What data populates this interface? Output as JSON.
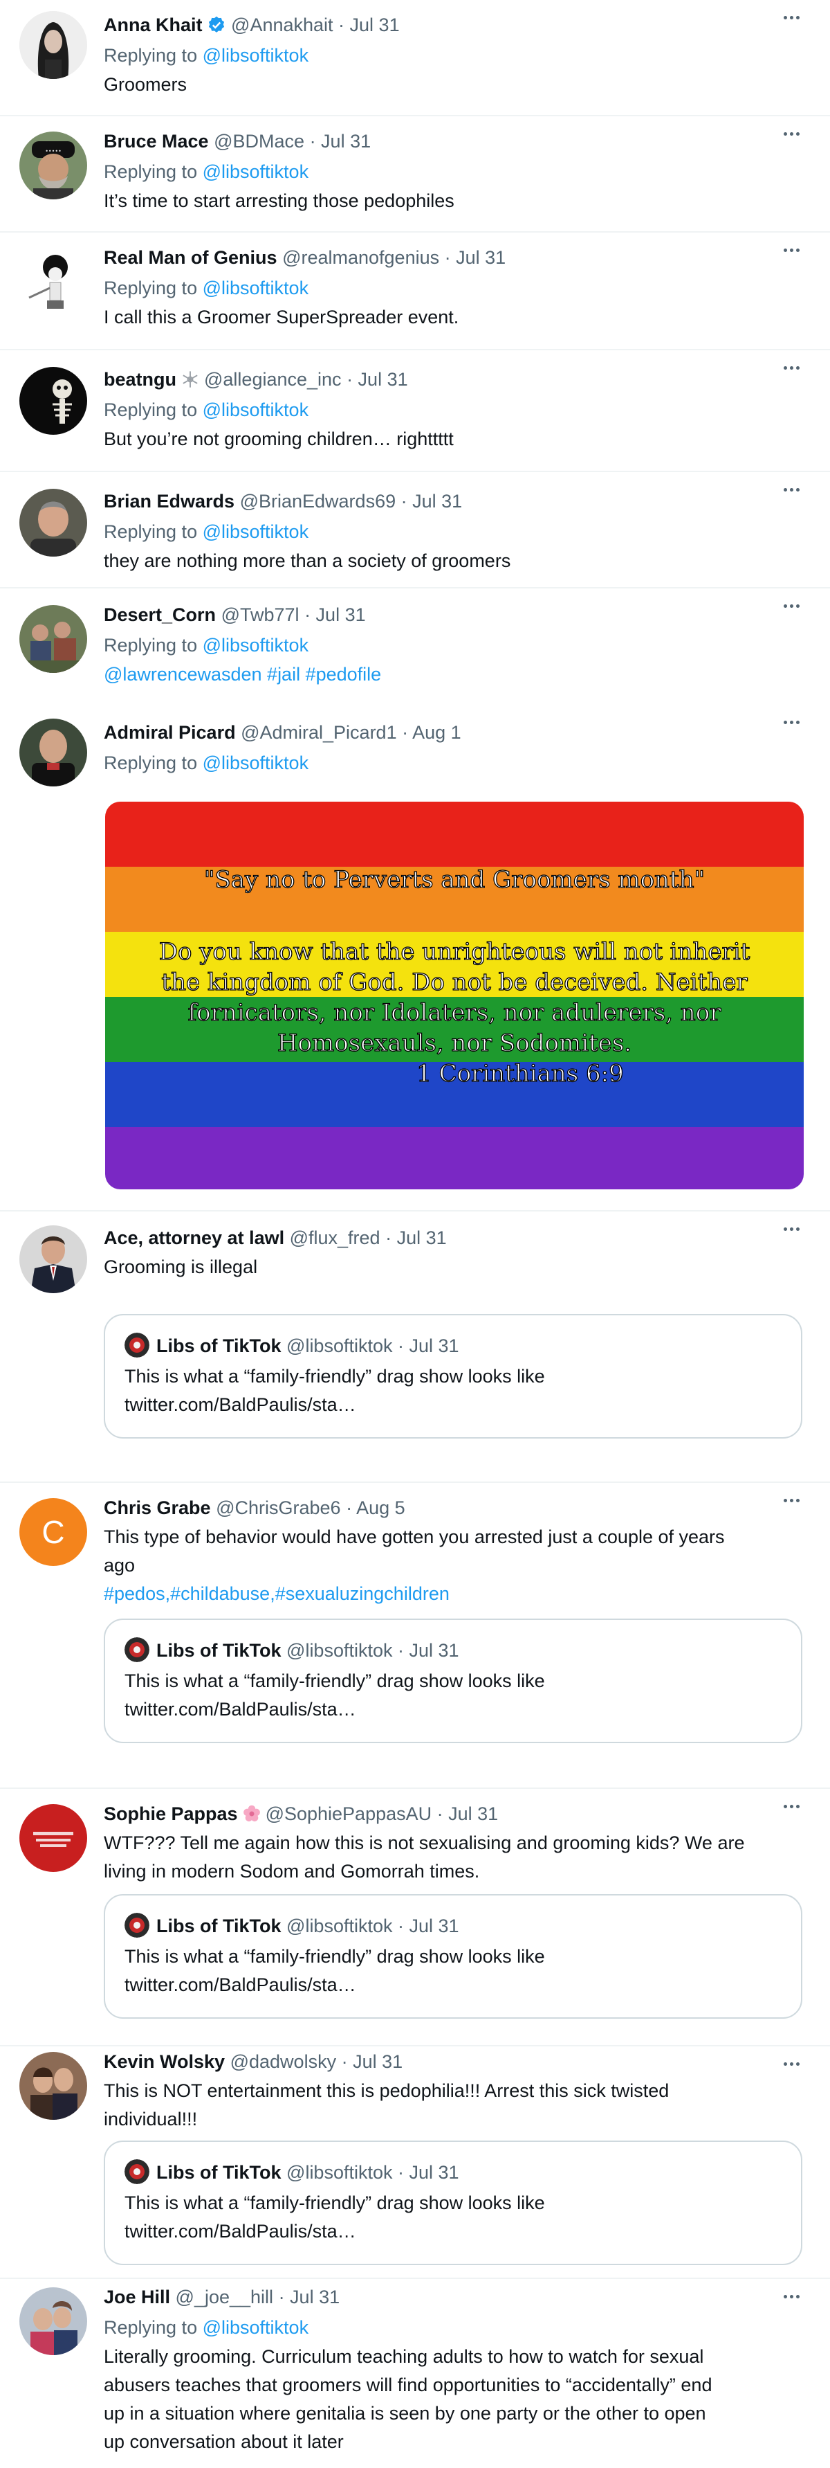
{
  "reply_label": "Replying to",
  "tweets": [
    {
      "name": "Anna Khait",
      "handle": "@Annakhait",
      "date": "· Jul 31",
      "replying_to": "@libsoftiktok",
      "text": "Groomers"
    },
    {
      "name": "Bruce Mace",
      "handle": "@BDMace",
      "date": "· Jul 31",
      "replying_to": "@libsoftiktok",
      "text": "It’s time to start arresting those pedophiles"
    },
    {
      "name": "Real Man of Genius",
      "handle": "@realmanofgenius",
      "date": "· Jul 31",
      "replying_to": "@libsoftiktok",
      "text": "I call this a Groomer SuperSpreader event."
    },
    {
      "name": "beatngu",
      "handle": "@allegiance_inc",
      "date": "· Jul 31",
      "replying_to": "@libsoftiktok",
      "text": "But you’re not grooming children… righttttt"
    },
    {
      "name": "Brian Edwards",
      "handle": "@BrianEdwards69",
      "date": "· Jul 31",
      "replying_to": "@libsoftiktok",
      "text": "they are nothing more than a society of groomers"
    },
    {
      "name": "Desert_Corn",
      "handle": "@Twb77l",
      "date": "· Jul 31",
      "replying_to": "@libsoftiktok",
      "mention": "@lawrencewasden",
      "hashtags": "#jail #pedofile"
    },
    {
      "name": "Admiral Picard",
      "handle": "@Admiral_Picard1",
      "date": "· Aug 1",
      "replying_to": "@libsoftiktok",
      "image_text": {
        "title": "\"Say no to Perverts and Groomers month\"",
        "lines": [
          "Do you know that the unrighteous will not inherit",
          "the kingdom of God. Do not be deceived. Neither",
          "fornicators, nor Idolaters, nor adulerers, nor",
          "Homosexauls, nor Sodomites."
        ],
        "reference": "1 Corinthians 6:9"
      }
    },
    {
      "name": "Ace, attorney at lawl",
      "handle": "@flux_fred",
      "date": "· Jul 31",
      "text": "Grooming is illegal",
      "quote": true
    },
    {
      "name": "Chris Grabe",
      "handle": "@ChrisGrabe6",
      "date": "· Aug 5",
      "text_1": "This type of behavior would have gotten you arrested just a couple of years",
      "text_2": "ago",
      "hashtags": "#pedos,#childabuse,#sexualuzingchildren",
      "avatar_letter": "C",
      "quote": true
    },
    {
      "name": "Sophie Pappas",
      "handle": "@SophiePappasAU",
      "date": "· Jul 31",
      "text_1": "WTF??? Tell me again how this is not sexualising and grooming kids? We are",
      "text_2": "living in modern Sodom and Gomorrah times.",
      "quote": true
    },
    {
      "name": "Kevin Wolsky",
      "handle": "@dadwolsky",
      "date": "· Jul 31",
      "text_1": "This is NOT entertainment this is pedophilia!!!  Arrest this sick twisted",
      "text_2": "individual!!!",
      "quote": true
    },
    {
      "name": "Joe Hill",
      "handle": "@_joe__hill",
      "date": "· Jul 31",
      "replying_to": "@libsoftiktok",
      "text_lines": [
        "Literally grooming. Curriculum teaching adults to how to watch for sexual",
        "abusers teaches that groomers will find opportunities to “accidentally” end",
        "up in a situation where genitalia is seen by one party or the other to open",
        "up conversation about it later"
      ]
    }
  ],
  "quoted": {
    "name": "Libs of TikTok",
    "handle": "@libsoftiktok",
    "date": "· Jul 31",
    "text": "This is what a “family-friendly” drag show looks like",
    "link": "twitter.com/BaldPaulis/sta…"
  },
  "colors": {
    "link": "#1d9bf0",
    "muted": "#536471",
    "text": "#0f1419",
    "border": "#eff3f4",
    "verified": "#1d9bf0",
    "avatar_orange": "#f4841c"
  },
  "icons": [
    "more-icon",
    "verified-icon",
    "snowflake-icon",
    "flower-icon"
  ]
}
